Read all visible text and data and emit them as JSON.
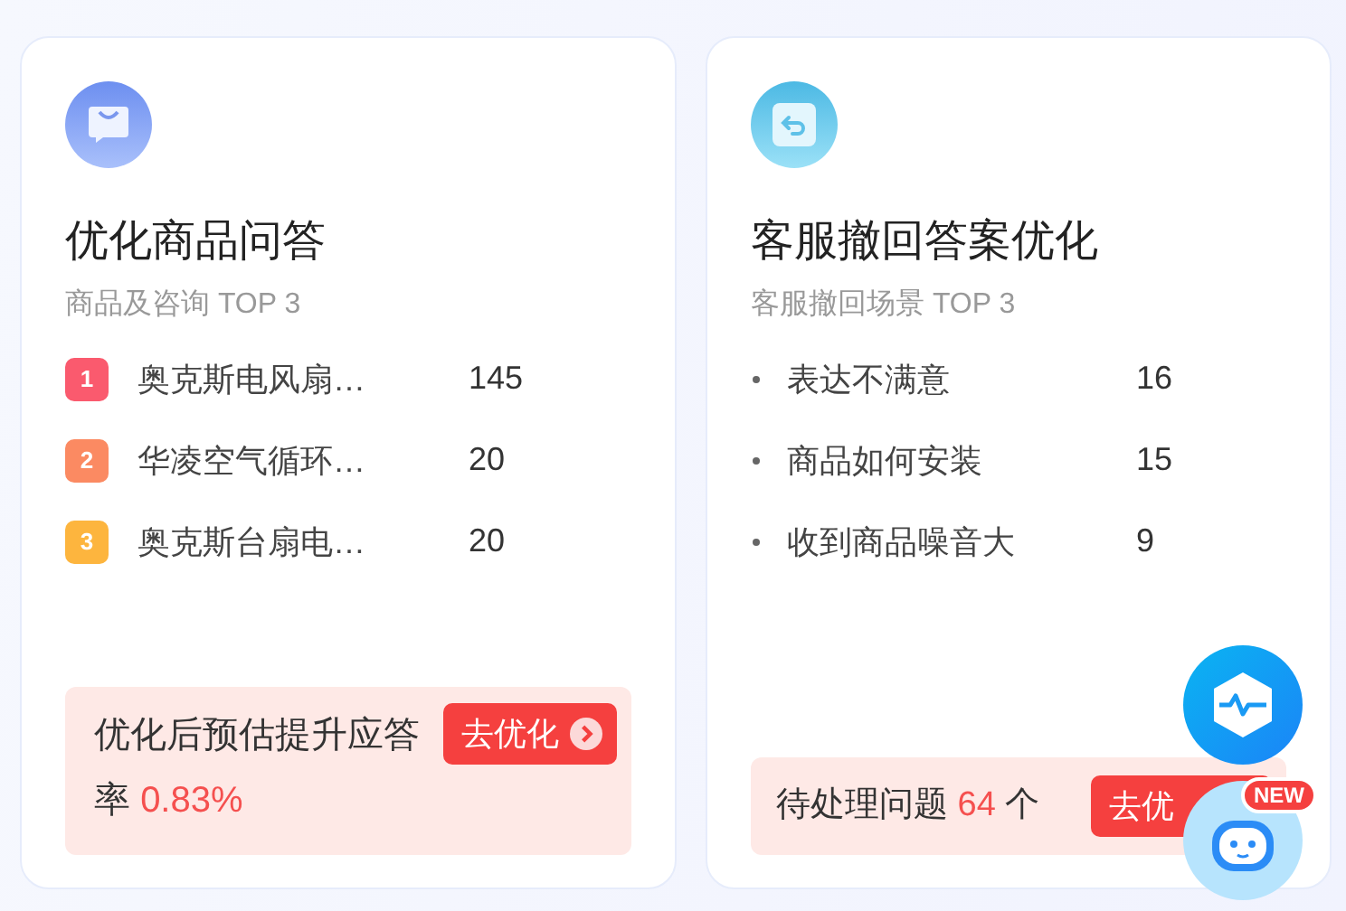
{
  "cards": [
    {
      "kind": "ranked",
      "title": "优化商品问答",
      "subtitle": "商品及咨询 TOP 3",
      "items": [
        {
          "rank": "1",
          "color": "#fa5a6e",
          "name": "奥克斯电风扇…",
          "count": "145"
        },
        {
          "rank": "2",
          "color": "#fb8a62",
          "name": "华凌空气循环…",
          "count": "20"
        },
        {
          "rank": "3",
          "color": "#fdb53e",
          "name": "奥克斯台扇电…",
          "count": "20"
        }
      ],
      "footer": {
        "text_before": "优化后预估提升应答率",
        "highlight": "0.83%",
        "button": "去优化",
        "button_arrow": true
      }
    },
    {
      "kind": "bulleted",
      "title": "客服撤回答案优化",
      "subtitle": "客服撤回场景 TOP 3",
      "items": [
        {
          "name": "表达不满意",
          "count": "16"
        },
        {
          "name": "商品如何安装",
          "count": "15"
        },
        {
          "name": "收到商品噪音大",
          "count": "9"
        }
      ],
      "footer": {
        "text_before": "待处理问题",
        "highlight": "64",
        "text_after": "个",
        "button": "去优",
        "button_arrow": false
      }
    }
  ],
  "floating": {
    "badge": "NEW"
  }
}
